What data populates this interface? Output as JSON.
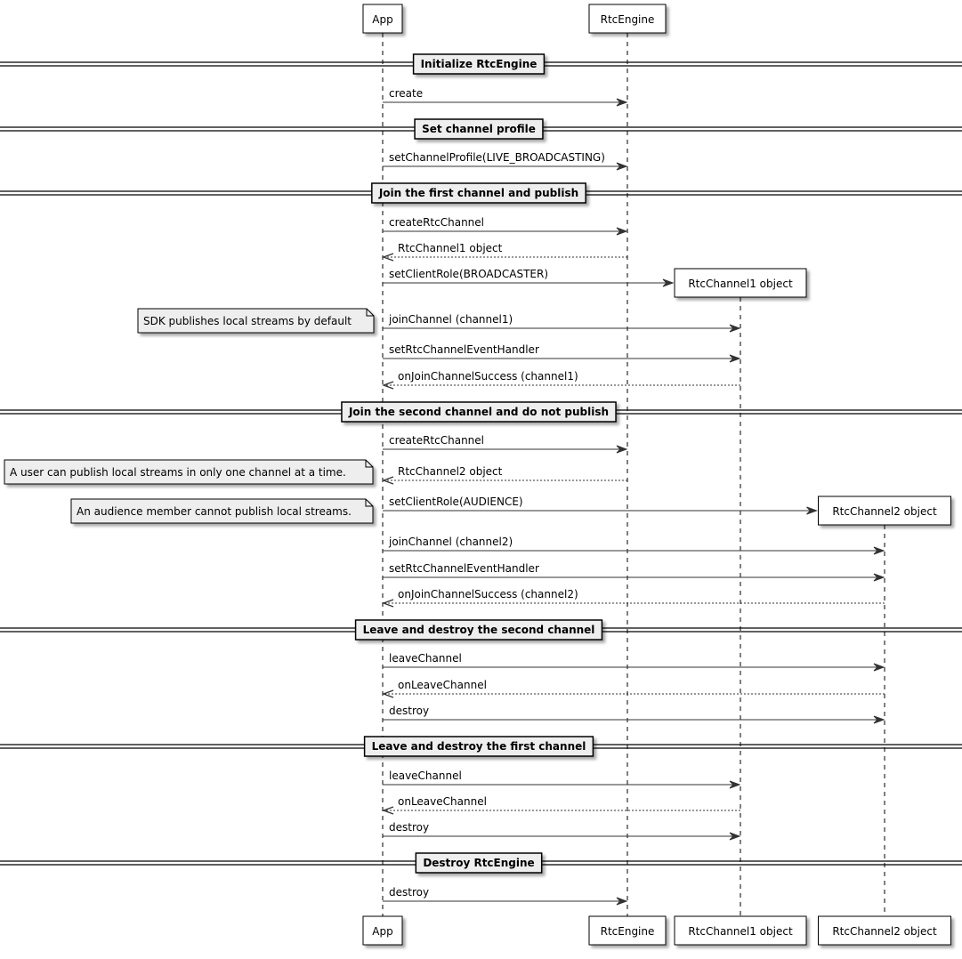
{
  "participants": [
    {
      "id": "app",
      "label": "App"
    },
    {
      "id": "engine",
      "label": "RtcEngine"
    },
    {
      "id": "ch1",
      "label": "RtcChannel1 object"
    },
    {
      "id": "ch2",
      "label": "RtcChannel2 object"
    }
  ],
  "colors": {
    "box_fill": "#ffffff",
    "divider_fill": "#eeeeee",
    "note_fill": "#eeeeee",
    "line": "#000000",
    "arrow": "#333333"
  },
  "sequence": [
    {
      "kind": "divider",
      "label": "Initialize RtcEngine"
    },
    {
      "kind": "msg",
      "from": "app",
      "to": "engine",
      "label": "create"
    },
    {
      "kind": "divider",
      "label": "Set channel profile"
    },
    {
      "kind": "msg",
      "from": "app",
      "to": "engine",
      "label": "setChannelProfile(LIVE_BROADCASTING)"
    },
    {
      "kind": "divider",
      "label": "Join the first channel and publish"
    },
    {
      "kind": "msg",
      "from": "app",
      "to": "engine",
      "label": "createRtcChannel"
    },
    {
      "kind": "return",
      "from": "engine",
      "to": "app",
      "label": "RtcChannel1 object"
    },
    {
      "kind": "create",
      "from": "app",
      "to": "ch1",
      "label": "setClientRole(BROADCASTER)"
    },
    {
      "kind": "msg",
      "from": "app",
      "to": "ch1",
      "label": "joinChannel (channel1)",
      "note": "SDK publishes local streams by default"
    },
    {
      "kind": "msg",
      "from": "app",
      "to": "ch1",
      "label": "setRtcChannelEventHandler"
    },
    {
      "kind": "return",
      "from": "ch1",
      "to": "app",
      "label": "onJoinChannelSuccess (channel1)"
    },
    {
      "kind": "divider",
      "label": "Join the second channel and do not publish"
    },
    {
      "kind": "msg",
      "from": "app",
      "to": "engine",
      "label": "createRtcChannel"
    },
    {
      "kind": "return",
      "from": "engine",
      "to": "app",
      "label": "RtcChannel2 object",
      "note": "A user can publish local streams in only one channel at a time."
    },
    {
      "kind": "create",
      "from": "app",
      "to": "ch2",
      "label": "setClientRole(AUDIENCE)",
      "note": "An audience member cannot publish local streams."
    },
    {
      "kind": "msg",
      "from": "app",
      "to": "ch2",
      "label": "joinChannel (channel2)"
    },
    {
      "kind": "msg",
      "from": "app",
      "to": "ch2",
      "label": "setRtcChannelEventHandler"
    },
    {
      "kind": "return",
      "from": "ch2",
      "to": "app",
      "label": "onJoinChannelSuccess (channel2)"
    },
    {
      "kind": "divider",
      "label": "Leave and destroy the second channel"
    },
    {
      "kind": "msg",
      "from": "app",
      "to": "ch2",
      "label": "leaveChannel"
    },
    {
      "kind": "return",
      "from": "ch2",
      "to": "app",
      "label": "onLeaveChannel"
    },
    {
      "kind": "msg",
      "from": "app",
      "to": "ch2",
      "label": "destroy"
    },
    {
      "kind": "divider",
      "label": "Leave and destroy the first channel"
    },
    {
      "kind": "msg",
      "from": "app",
      "to": "ch1",
      "label": "leaveChannel"
    },
    {
      "kind": "return",
      "from": "ch1",
      "to": "app",
      "label": "onLeaveChannel"
    },
    {
      "kind": "msg",
      "from": "app",
      "to": "ch1",
      "label": "destroy"
    },
    {
      "kind": "divider",
      "label": "Destroy RtcEngine"
    },
    {
      "kind": "msg",
      "from": "app",
      "to": "engine",
      "label": "destroy"
    }
  ]
}
